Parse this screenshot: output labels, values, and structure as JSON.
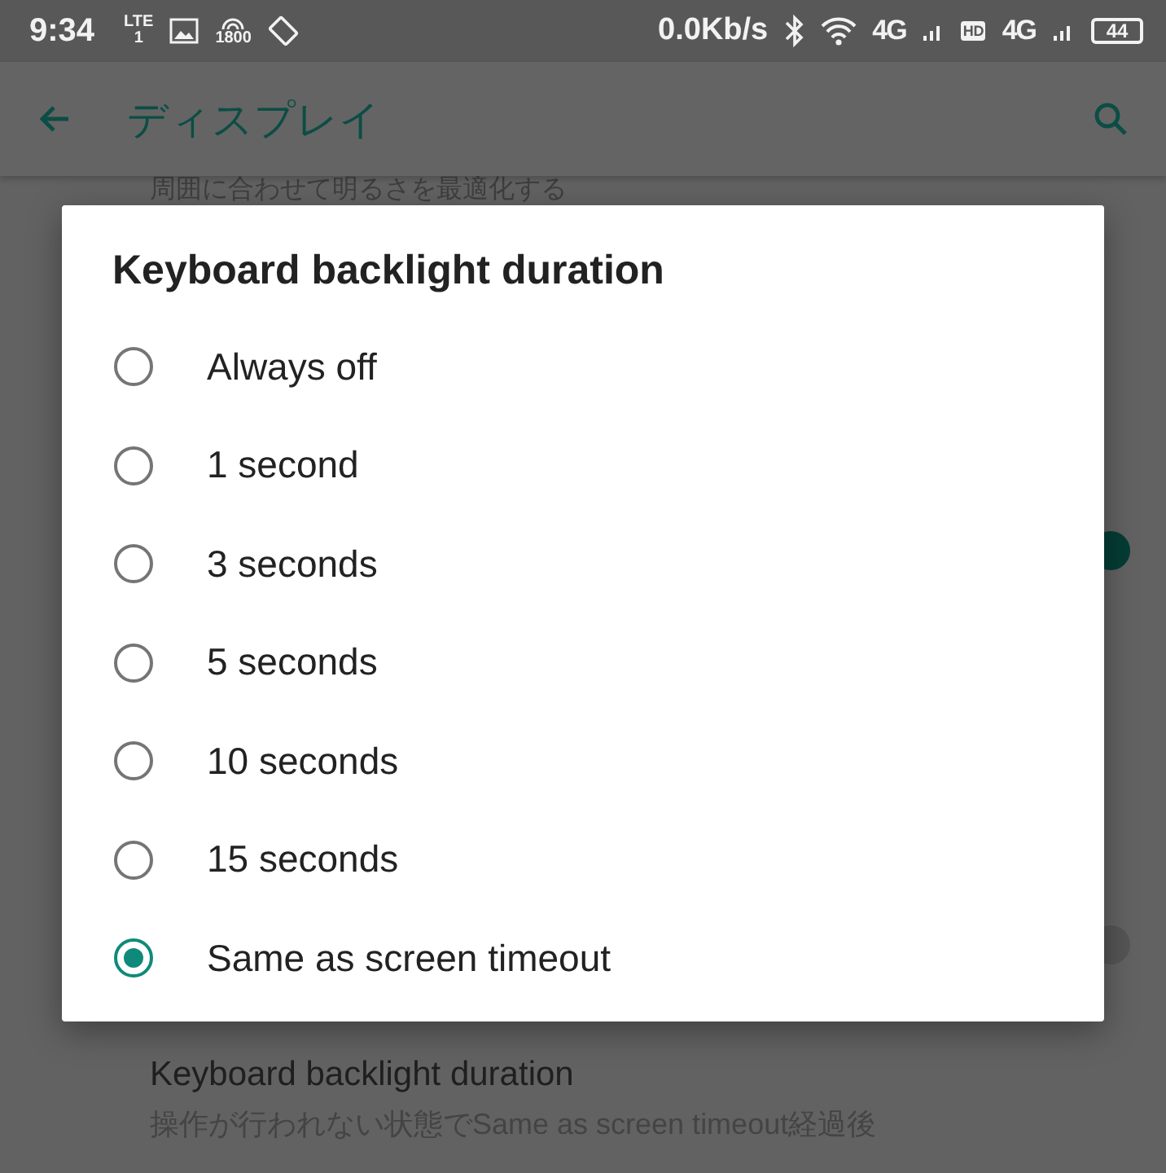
{
  "status_bar": {
    "time": "9:34",
    "lte_top": "LTE",
    "lte_sub": "1",
    "band": "1800",
    "speed": "0.0Kb/s",
    "network_1": "4G",
    "hd": "HD",
    "network_2": "4G",
    "battery": "44"
  },
  "toolbar": {
    "title": "ディスプレイ"
  },
  "background": {
    "partial_text": "周囲に合わせて明るさを最適化する",
    "switches": [
      {
        "on": true
      },
      {
        "on": false
      }
    ],
    "setting": {
      "title": "Keyboard backlight duration",
      "summary": "操作が行われない状態でSame as screen timeout経過後"
    }
  },
  "dialog": {
    "title": "Keyboard backlight duration",
    "options": [
      {
        "label": "Always off",
        "selected": false
      },
      {
        "label": "1 second",
        "selected": false
      },
      {
        "label": "3 seconds",
        "selected": false
      },
      {
        "label": "5 seconds",
        "selected": false
      },
      {
        "label": "10 seconds",
        "selected": false
      },
      {
        "label": "15 seconds",
        "selected": false
      },
      {
        "label": "Same as screen timeout",
        "selected": true
      }
    ]
  }
}
